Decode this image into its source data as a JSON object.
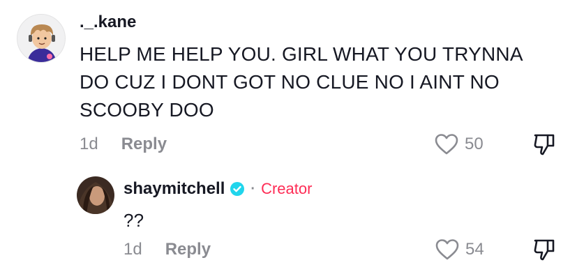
{
  "comments": [
    {
      "username": "._.kane",
      "text": "HELP ME HELP YOU. GIRL WHAT YOU TRYNNA DO CUZ I DONT GOT NO CLUE NO I AINT NO SCOOBY DOO",
      "time": "1d",
      "reply_label": "Reply",
      "likes": "50"
    },
    {
      "username": "shaymitchell",
      "verified": true,
      "separator": "·",
      "badge": "Creator",
      "text": "??",
      "time": "1d",
      "reply_label": "Reply",
      "likes": "54"
    }
  ],
  "icons": {
    "like": "heart-outline-icon",
    "dislike": "thumbs-down-icon",
    "verified": "verified-check-icon"
  },
  "colors": {
    "text": "#161823",
    "muted": "#8a8b91",
    "creator": "#fe2c55",
    "verified": "#20d5ec"
  }
}
